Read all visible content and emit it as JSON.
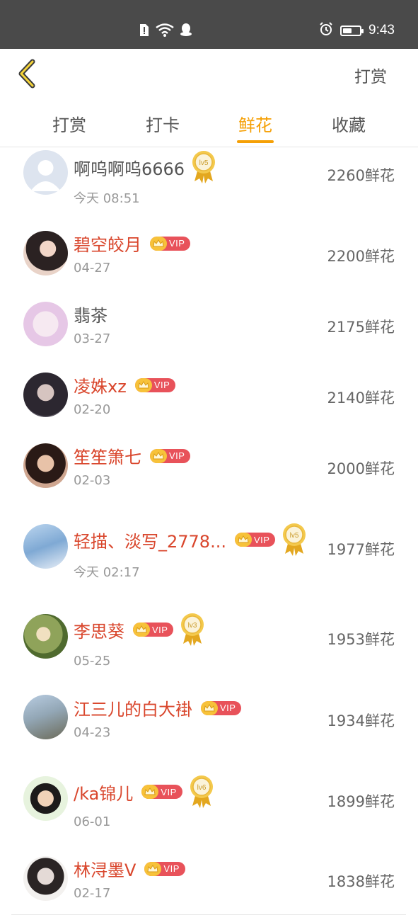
{
  "status_bar": {
    "time": "9:43",
    "battery_level": 0.55
  },
  "header": {
    "action_label": "打赏"
  },
  "tabs": [
    {
      "label": "打赏",
      "active": false
    },
    {
      "label": "打卡",
      "active": false
    },
    {
      "label": "鲜花",
      "active": true
    },
    {
      "label": "收藏",
      "active": false
    }
  ],
  "colors": {
    "accent": "#f5a006",
    "vip_name": "#d9462c",
    "vip_badge": "#e8525a",
    "gold": "#f7c23a"
  },
  "rows": [
    {
      "name": "啊呜啊呜6666",
      "date": "今天 08:51",
      "amount": "2260鲜花",
      "vip": false,
      "level": "lv5",
      "avatar": "default-avatar"
    },
    {
      "name": "碧空皎月",
      "date": "04-27",
      "amount": "2200鲜花",
      "vip": true,
      "vip_label": "VIP",
      "level": null,
      "avatar": "user-photo"
    },
    {
      "name": "翡茶",
      "date": "03-27",
      "amount": "2175鲜花",
      "vip": false,
      "level": null,
      "avatar": "user-photo"
    },
    {
      "name": "凌姝xz",
      "date": "02-20",
      "amount": "2140鲜花",
      "vip": true,
      "vip_label": "VIP",
      "level": null,
      "avatar": "user-photo"
    },
    {
      "name": "笙笙箫七",
      "date": "02-03",
      "amount": "2000鲜花",
      "vip": true,
      "vip_label": "VIP",
      "level": null,
      "avatar": "user-photo"
    },
    {
      "name": "轻描、淡写_2778...",
      "date": "今天 02:17",
      "amount": "1977鲜花",
      "vip": true,
      "vip_label": "VIP",
      "level": "lv5",
      "avatar": "user-photo"
    },
    {
      "name": "李思葵",
      "date": "05-25",
      "amount": "1953鲜花",
      "vip": true,
      "vip_label": "VIP",
      "level": "lv3",
      "avatar": "user-photo"
    },
    {
      "name": "江三儿的白大褂",
      "date": "04-23",
      "amount": "1934鲜花",
      "vip": true,
      "vip_label": "VIP",
      "level": null,
      "avatar": "user-photo"
    },
    {
      "name": "/ka锦儿",
      "date": "06-01",
      "amount": "1899鲜花",
      "vip": true,
      "vip_label": "VIP",
      "level": "lv6",
      "avatar": "user-photo"
    },
    {
      "name": "林浔墨V",
      "date": "02-17",
      "amount": "1838鲜花",
      "vip": true,
      "vip_label": "VIP",
      "level": null,
      "avatar": "user-photo"
    }
  ]
}
